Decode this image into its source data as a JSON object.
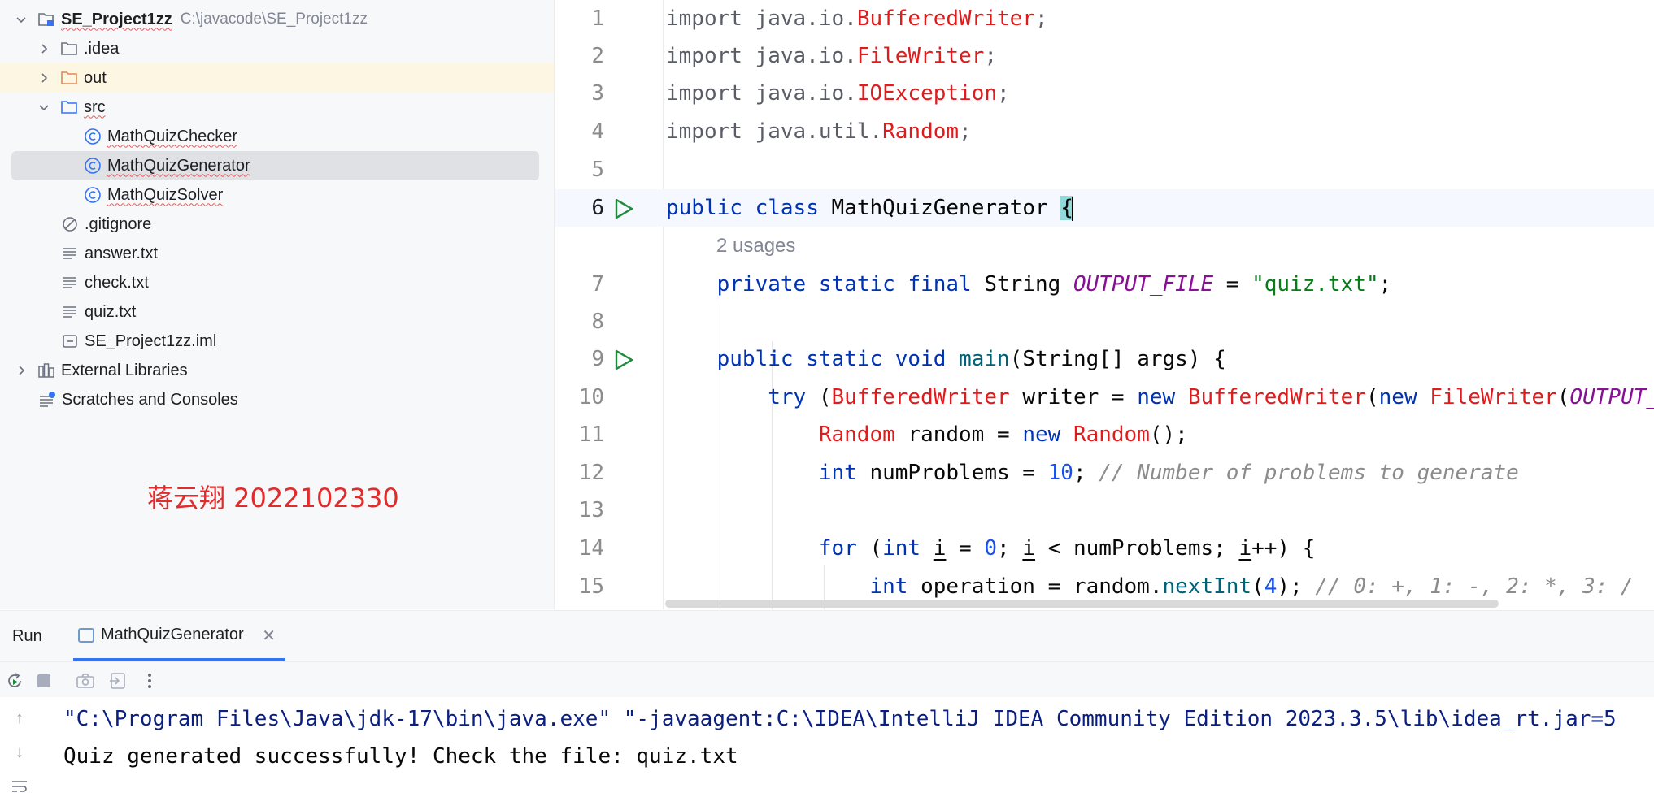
{
  "project_tree": {
    "root": {
      "name": "SE_Project1zz",
      "path": "C:\\javacode\\SE_Project1zz"
    },
    "items": [
      {
        "label": ".idea",
        "kind": "folder"
      },
      {
        "label": "out",
        "kind": "folder-excluded"
      },
      {
        "label": "src",
        "kind": "source-folder"
      },
      {
        "label": "MathQuizChecker",
        "kind": "class"
      },
      {
        "label": "MathQuizGenerator",
        "kind": "class"
      },
      {
        "label": "MathQuizSolver",
        "kind": "class"
      },
      {
        "label": ".gitignore",
        "kind": "ignore-file"
      },
      {
        "label": "answer.txt",
        "kind": "text-file"
      },
      {
        "label": "check.txt",
        "kind": "text-file"
      },
      {
        "label": "quiz.txt",
        "kind": "text-file"
      },
      {
        "label": "SE_Project1zz.iml",
        "kind": "module-file"
      },
      {
        "label": "External Libraries",
        "kind": "library"
      },
      {
        "label": "Scratches and Consoles",
        "kind": "scratches"
      }
    ]
  },
  "author_note": "蒋云翔 2022102330",
  "editor": {
    "line_numbers": [
      "1",
      "2",
      "3",
      "4",
      "5",
      "6",
      "7",
      "8",
      "9",
      "10",
      "11",
      "12",
      "13",
      "14",
      "15"
    ],
    "inlay_hint": "2 usages",
    "code": {
      "l1": [
        "import java.io.",
        "BufferedWriter",
        ";"
      ],
      "l2": [
        "import java.io.",
        "FileWriter",
        ";"
      ],
      "l3": [
        "import java.io.",
        "IOException",
        ";"
      ],
      "l4": [
        "import java.util.",
        "Random",
        ";"
      ],
      "l6": [
        "public",
        " ",
        "class",
        " MathQuizGenerator ",
        "{"
      ],
      "l7": [
        "    ",
        "private",
        " ",
        "static",
        " ",
        "final",
        " String ",
        "OUTPUT_FILE",
        " = ",
        "\"quiz.txt\"",
        ";"
      ],
      "l9": [
        "    ",
        "public",
        " ",
        "static",
        " ",
        "void",
        " ",
        "main",
        "(String[] args) {"
      ],
      "l10": [
        "        ",
        "try",
        " (",
        "BufferedWriter",
        " writer = ",
        "new",
        " ",
        "BufferedWriter",
        "(",
        "new",
        " ",
        "FileWriter",
        "(",
        "OUTPUT_FILE"
      ],
      "l11": [
        "            ",
        "Random",
        " random = ",
        "new",
        " ",
        "Random",
        "();"
      ],
      "l12": [
        "            ",
        "int",
        " numProblems = ",
        "10",
        "; ",
        "// Number of problems to generate"
      ],
      "l14": [
        "            ",
        "for",
        " (",
        "int",
        " ",
        "i",
        " = ",
        "0",
        "; ",
        "i",
        " < numProblems; ",
        "i",
        "++) {"
      ],
      "l15": [
        "                ",
        "int",
        " operation = random.",
        "nextInt",
        "(",
        "4",
        "); ",
        "// 0: +, 1: -, 2: *, 3: /"
      ]
    },
    "colors": {
      "keyword": "#0033b3",
      "unresolved_class": "#e11b1b",
      "constant": "#871094",
      "string": "#067d17",
      "number": "#1750eb",
      "comment": "#8c8c8c",
      "method": "#00627a",
      "run_gutter": "#208a3c"
    }
  },
  "run_panel": {
    "title": "Run",
    "tab_label": "MathQuizGenerator",
    "toolbar_icons": [
      "rerun-icon",
      "stop-icon",
      "camera-icon",
      "exit-icon",
      "more-icon"
    ],
    "console": {
      "command": "\"C:\\Program Files\\Java\\jdk-17\\bin\\java.exe\" \"-javaagent:C:\\IDEA\\IntelliJ IDEA Community Edition 2023.3.5\\lib\\idea_rt.jar=5",
      "output": "Quiz generated successfully! Check the file: quiz.txt"
    }
  }
}
